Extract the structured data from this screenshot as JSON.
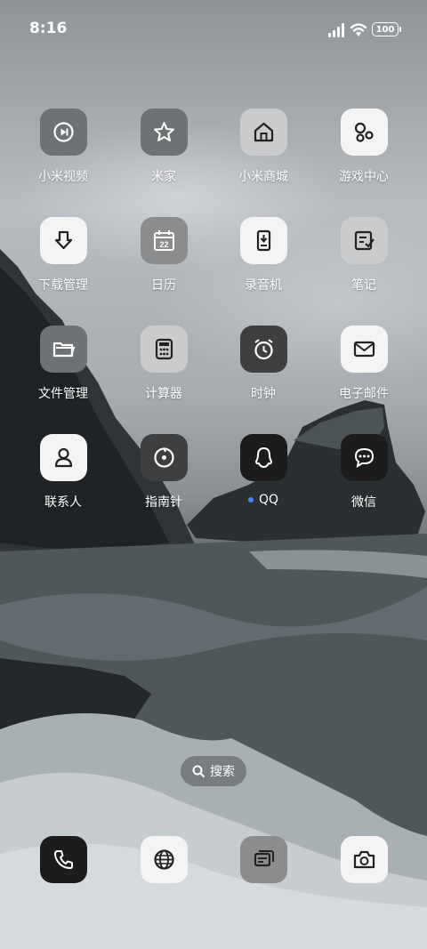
{
  "status": {
    "time": "8:16",
    "battery": "100"
  },
  "apps": [
    {
      "label": "小米视频",
      "icon": "play-icon",
      "style": "g-mid"
    },
    {
      "label": "米家",
      "icon": "star-icon",
      "style": "g-mid"
    },
    {
      "label": "小米商城",
      "icon": "home-icon",
      "style": "g-light"
    },
    {
      "label": "游戏中心",
      "icon": "game-icon",
      "style": "g-white"
    },
    {
      "label": "下载管理",
      "icon": "download-icon",
      "style": "g-white"
    },
    {
      "label": "日历",
      "icon": "calendar-icon",
      "style": "g-gray",
      "badge": "22"
    },
    {
      "label": "录音机",
      "icon": "recorder-icon",
      "style": "g-white"
    },
    {
      "label": "笔记",
      "icon": "notes-icon",
      "style": "g-light"
    },
    {
      "label": "文件管理",
      "icon": "folder-icon",
      "style": "g-mid"
    },
    {
      "label": "计算器",
      "icon": "calculator-icon",
      "style": "g-light"
    },
    {
      "label": "时钟",
      "icon": "clock-icon",
      "style": "g-dark"
    },
    {
      "label": "电子邮件",
      "icon": "mail-icon",
      "style": "g-white"
    },
    {
      "label": "联系人",
      "icon": "contact-icon",
      "style": "g-white"
    },
    {
      "label": "指南针",
      "icon": "compass-icon",
      "style": "g-dark"
    },
    {
      "label": "QQ",
      "icon": "qq-icon",
      "style": "g-black",
      "new": true
    },
    {
      "label": "微信",
      "icon": "chat-icon",
      "style": "g-black"
    }
  ],
  "search": {
    "label": "搜索"
  },
  "dock": [
    {
      "icon": "phone-icon",
      "style": "g-black"
    },
    {
      "icon": "browser-icon",
      "style": "g-white"
    },
    {
      "icon": "messages-icon",
      "style": "g-gray"
    },
    {
      "icon": "camera-icon",
      "style": "g-white"
    }
  ]
}
